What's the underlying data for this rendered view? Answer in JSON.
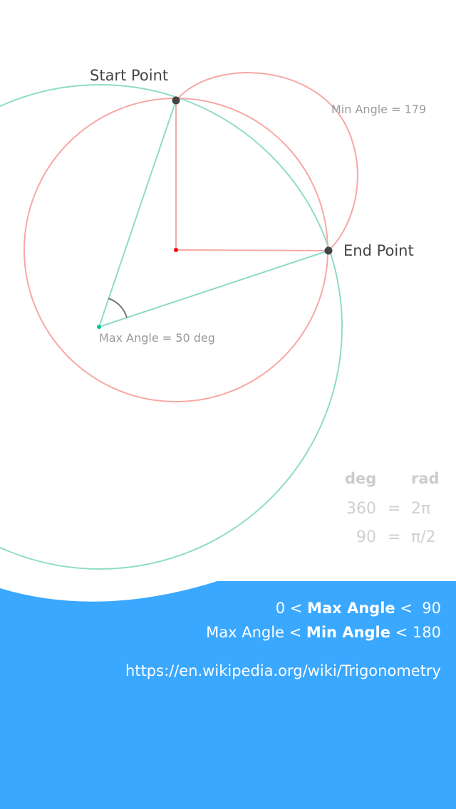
{
  "diagram": {
    "start_point_label": "Start Point",
    "end_point_label": "End Point",
    "min_angle_label": "Min Angle = 179",
    "max_angle_label": "Max Angle = 50 deg"
  },
  "conversion_table": {
    "header_deg": "deg",
    "header_rad": "rad",
    "rows": [
      {
        "deg": "360",
        "eq": "=",
        "rad": "2π"
      },
      {
        "deg": "90",
        "eq": "=",
        "rad": "π/2"
      }
    ]
  },
  "constraints": {
    "line1_prefix": "0 < ",
    "line1_bold": "Max Angle",
    "line1_suffix": " <  90",
    "line2_prefix": "Max Angle < ",
    "line2_bold": "Min Angle",
    "line2_suffix": " < 180"
  },
  "link": {
    "url": "https://en.wikipedia.org/wiki/Trigonometry"
  },
  "colors": {
    "green": "#8fdcc8",
    "red": "#f7a8a6",
    "blue": "#3aa8ff",
    "dark_point": "#444444",
    "center_red": "#ff0000",
    "center_green": "#00c89a"
  }
}
